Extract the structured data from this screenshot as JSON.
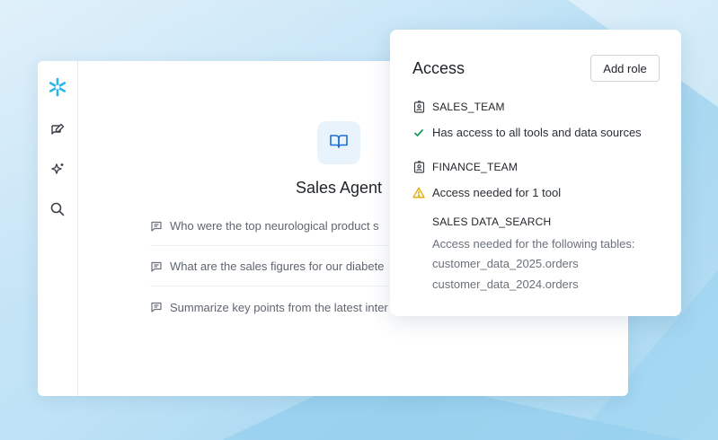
{
  "agent": {
    "title": "Sales Agent",
    "prompts": [
      "Who were the top neurological product s",
      "What are the sales figures for our diabete",
      "Summarize key points from the latest inter"
    ]
  },
  "rail": {
    "icons": [
      "snowflake-logo-icon",
      "new-chat-icon",
      "sparkle-icon",
      "search-icon"
    ]
  },
  "access": {
    "title": "Access",
    "add_role_label": "Add role",
    "teams": [
      {
        "name": "SALES_TEAM",
        "status": "Has access to all tools and data sources",
        "status_kind": "ok"
      },
      {
        "name": "FINANCE_TEAM",
        "status": "Access needed for 1 tool",
        "status_kind": "warning"
      }
    ],
    "detail": {
      "tool": "SALES DATA_SEARCH",
      "lines": [
        "Access needed for the following tables:",
        "customer_data_2025.orders",
        "customer_data_2024.orders"
      ]
    }
  },
  "colors": {
    "brand": "#29b5e8",
    "success": "#1a9b5f",
    "warning": "#e0a800",
    "badge_bg": "#e9f3fc",
    "badge_icon": "#1f6fd0"
  }
}
